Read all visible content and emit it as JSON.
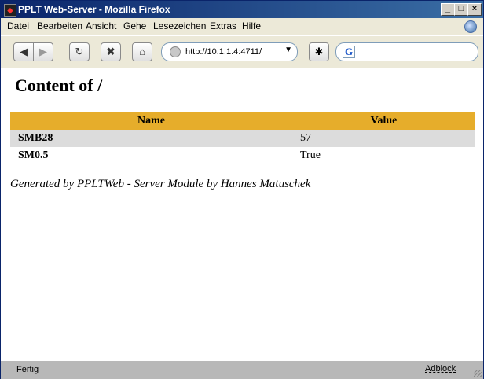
{
  "window": {
    "title": "PPLT Web-Server - Mozilla Firefox"
  },
  "menu": [
    "Datei",
    "Bearbeiten",
    "Ansicht",
    "Gehe",
    "Lesezeichen",
    "Extras",
    "Hilfe"
  ],
  "toolbar": {
    "url": "http://10.1.1.4:4711/",
    "search_value": ""
  },
  "page": {
    "heading": "Content of /",
    "table": {
      "headers": [
        "Name",
        "Value"
      ],
      "rows": [
        [
          "SMB28",
          "57"
        ],
        [
          "SM0.5",
          "True"
        ]
      ]
    },
    "footer": "Generated by PPLTWeb - Server Module by Hannes Matuschek"
  },
  "status": {
    "text": "Fertig",
    "adblock": "Adblock"
  },
  "colors": {
    "table_header": "#e6ad2b",
    "row_alt": "#dcdcdc",
    "titlebar": "#0a246a"
  }
}
